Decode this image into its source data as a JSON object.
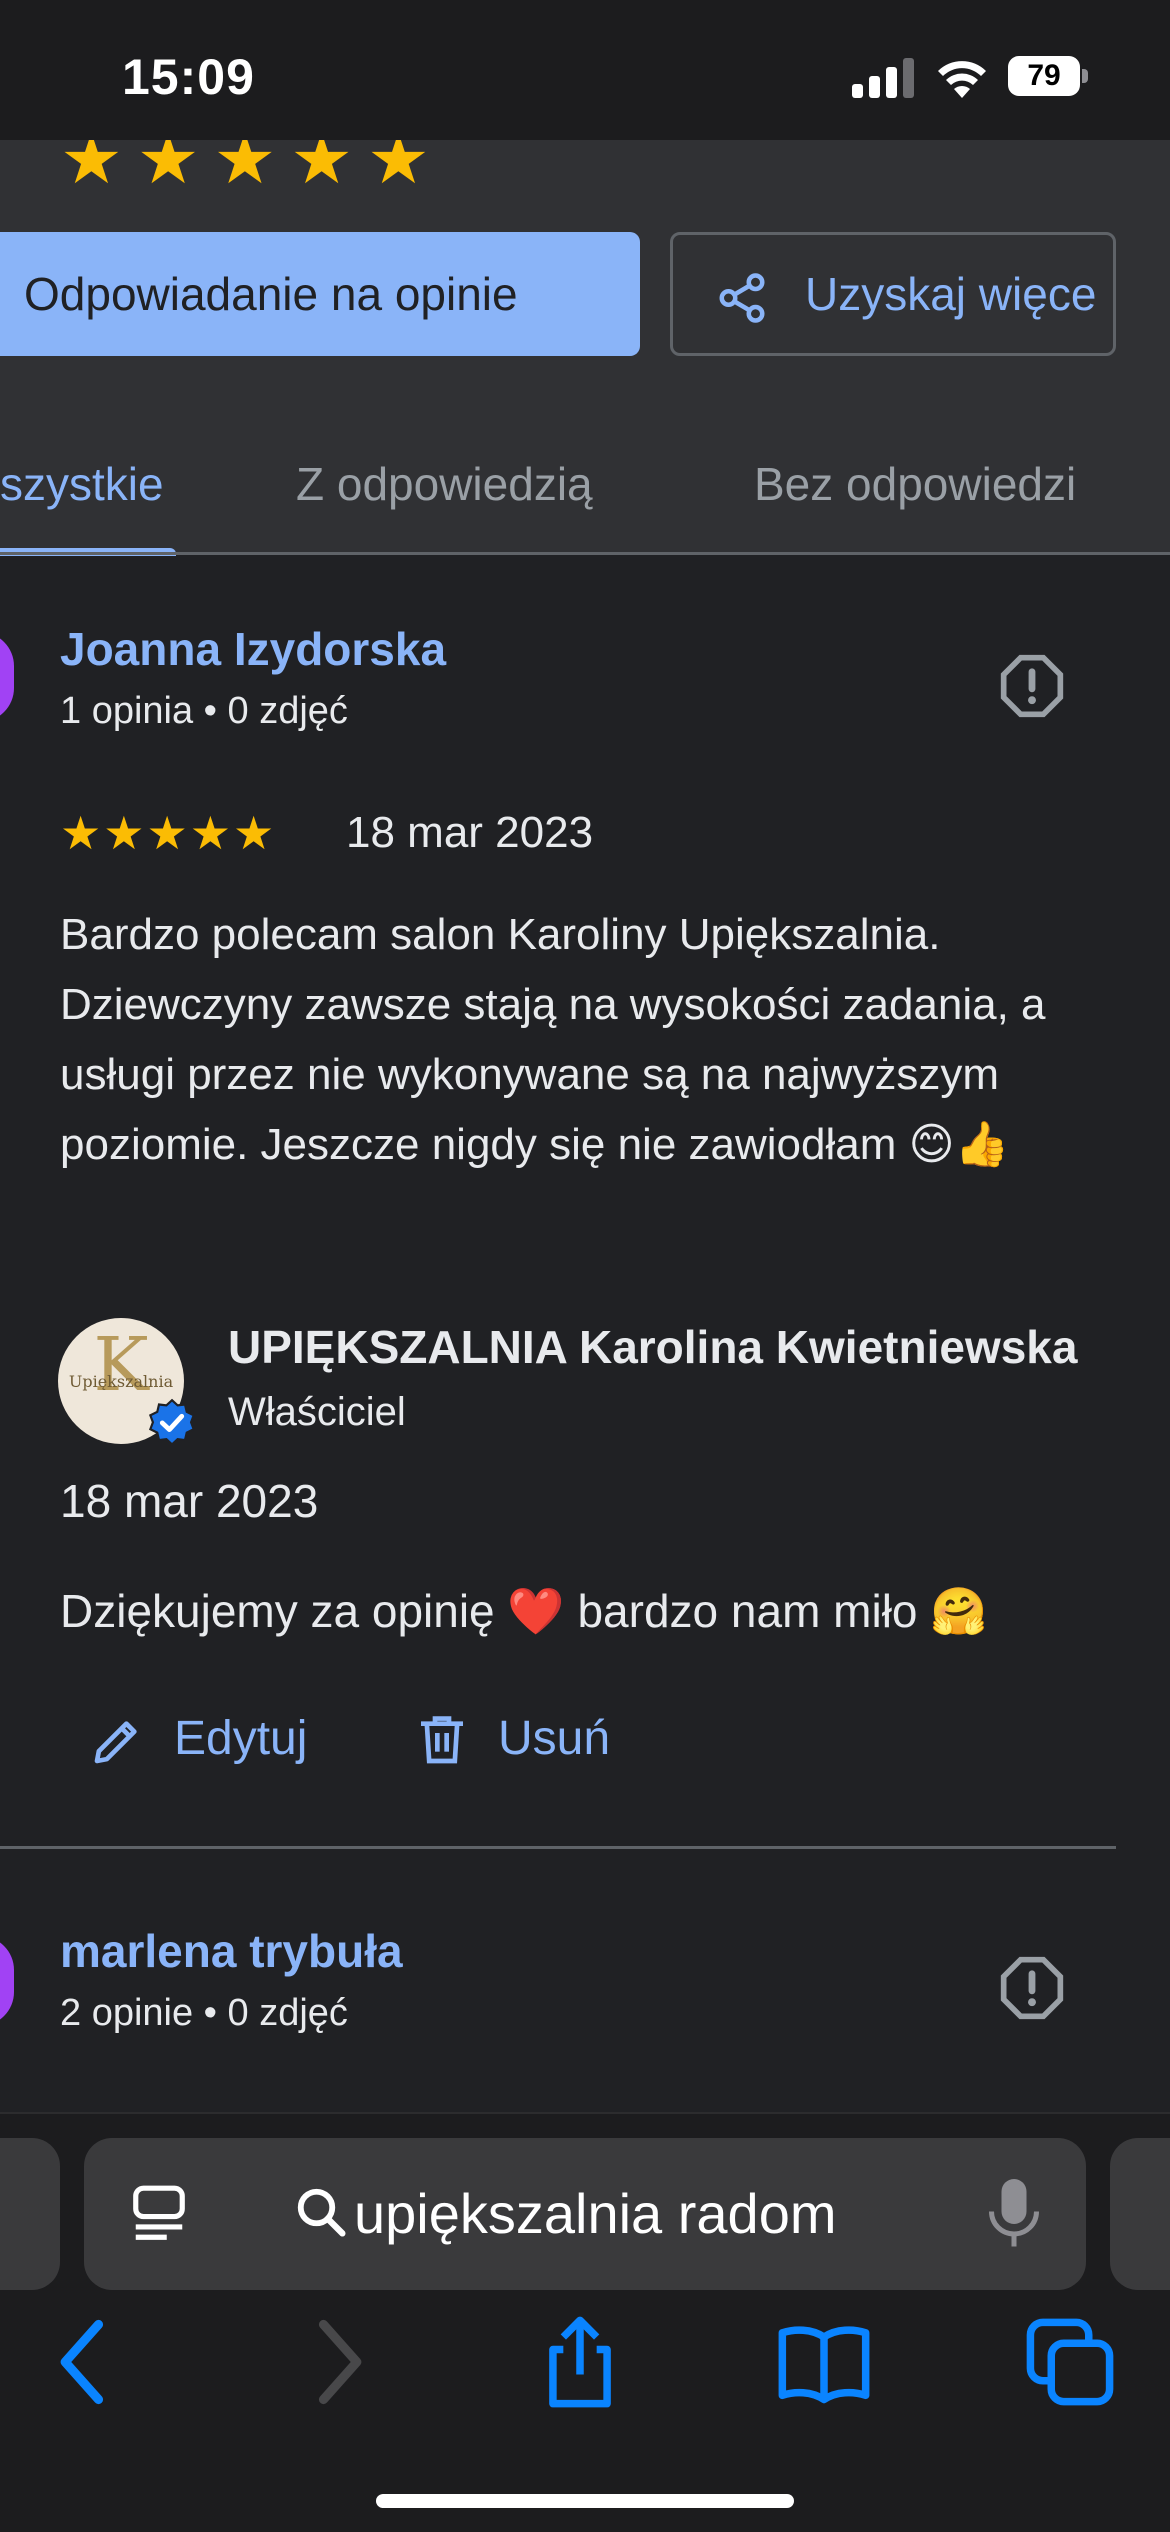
{
  "status_bar": {
    "time": "15:09",
    "battery": "79"
  },
  "actions": {
    "reply_button": "Odpowiadanie na opinie",
    "share_button": "Uzyskaj więce"
  },
  "tabs": [
    {
      "label": "szystkie",
      "active": true
    },
    {
      "label": "Z odpowiedzią",
      "active": false
    },
    {
      "label": "Bez odpowiedzi",
      "active": false
    }
  ],
  "reviews": [
    {
      "name": "Joanna Izydorska",
      "meta": "1 opinia • 0 zdjęć",
      "stars": "★★★★★",
      "rating": 5,
      "date": "18 mar 2023",
      "text": "Bardzo polecam salon Karoliny Upiększalnia. Dziewczyny zawsze stają na wysokości zadania, a usługi przez nie wykonywane są na najwyższym poziomie. Jeszcze nigdy się nie zawiodłam 😊👍",
      "owner_reply": {
        "name": "UPIĘKSZALNIA Karolina Kwietniewska",
        "role": "Właściciel",
        "logo_letter": "K",
        "logo_word": "Upiększalnia",
        "date": "18 mar 2023",
        "text": "Dziękujemy za opinię ❤️ bardzo nam miło 🤗",
        "edit_label": "Edytuj",
        "delete_label": "Usuń"
      }
    },
    {
      "name": "marlena trybuła",
      "meta": "2 opinie • 0 zdjęć"
    }
  ],
  "browser": {
    "address": "upiększalnia radom"
  },
  "colors": {
    "background": "#202124",
    "accent": "#8ab4f8",
    "star": "#fbbc04"
  },
  "icons": [
    "share-icon",
    "report-flag-icon",
    "verified-badge-icon",
    "pencil-icon",
    "trash-icon",
    "reader-icon",
    "search-icon",
    "microphone-icon",
    "back-icon",
    "forward-icon",
    "share-sheet-icon",
    "bookmarks-icon",
    "tabs-icon"
  ]
}
